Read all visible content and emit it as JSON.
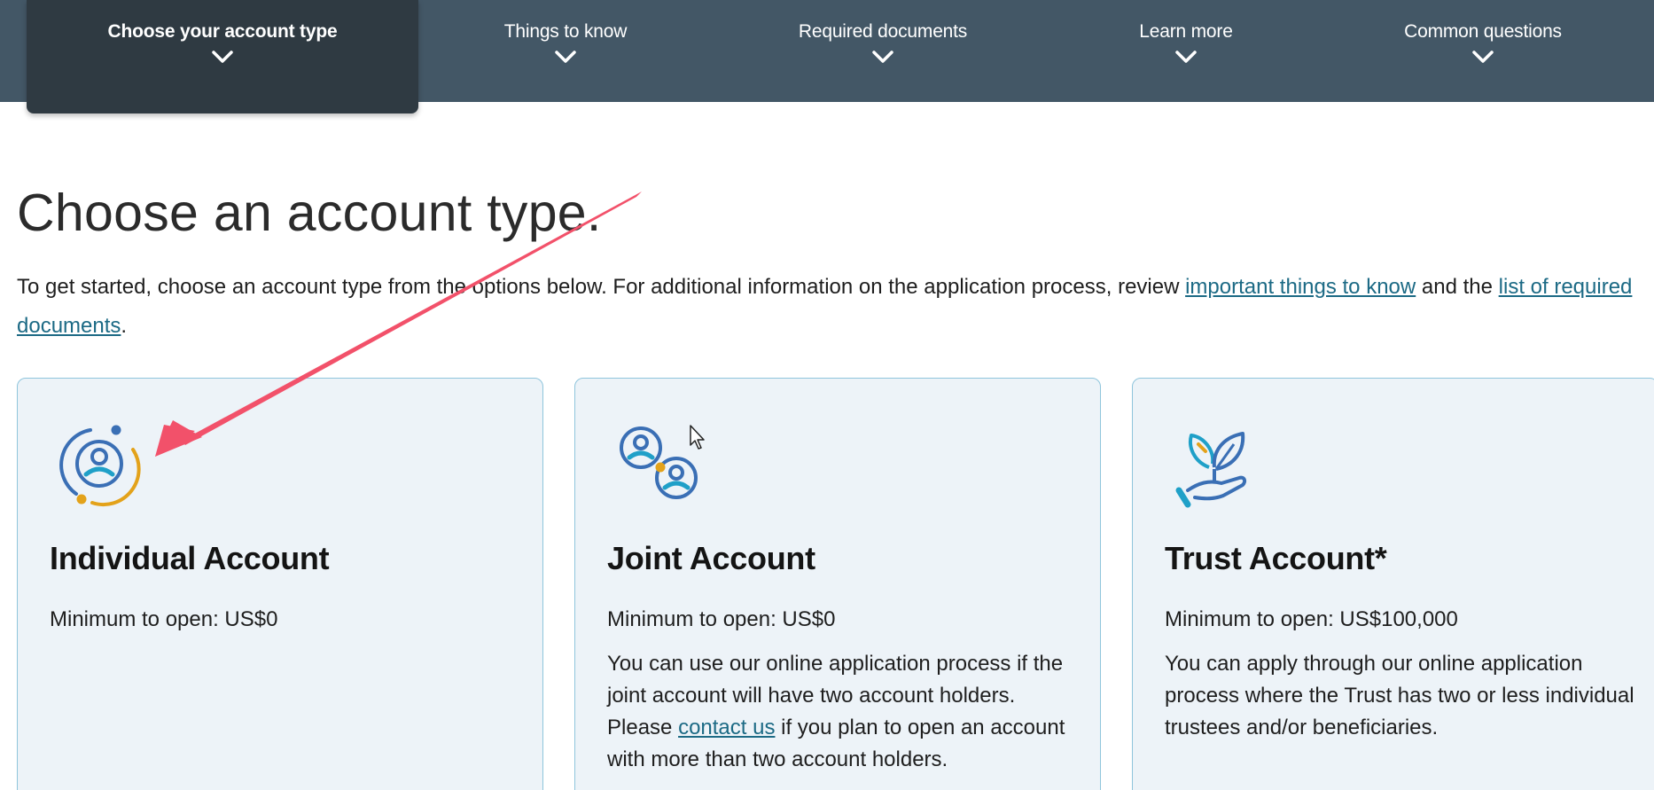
{
  "nav": {
    "tabs": [
      {
        "label": "Choose your account type",
        "active": true
      },
      {
        "label": "Things to know",
        "active": false
      },
      {
        "label": "Required documents",
        "active": false
      },
      {
        "label": "Learn more",
        "active": false
      },
      {
        "label": "Common questions",
        "active": false
      }
    ]
  },
  "main": {
    "title": "Choose an account type.",
    "intro": {
      "text1": "To get started, choose an account type from the options below. For additional information on the application process, review ",
      "link1": "important things to know",
      "text2": " and the ",
      "link2": "list of required documents",
      "text3": "."
    }
  },
  "cards": [
    {
      "icon": "individual-account-icon",
      "title": "Individual Account",
      "minimum": "Minimum to open: US$0"
    },
    {
      "icon": "joint-account-icon",
      "title": "Joint Account",
      "minimum": "Minimum to open: US$0",
      "desc1": "You can use our online application process if the joint account will have two account holders. Please ",
      "desc_link": "contact us",
      "desc2": " if you plan to open an account with more than two account holders."
    },
    {
      "icon": "trust-account-icon",
      "title": "Trust Account*",
      "minimum": "Minimum to open: US$100,000",
      "desc1": "You can apply through our online application process where the Trust has two or less individual trustees and/or beneficiaries."
    }
  ],
  "colors": {
    "nav_bg": "#435766",
    "nav_active_bg": "#2f3a42",
    "card_bg": "#edf3f8",
    "card_border": "#8fc5dc",
    "link": "#1c6a85",
    "icon_blue": "#3a6fb5",
    "icon_teal": "#1fa0c8",
    "icon_gold": "#e3a21a",
    "annotation_arrow": "#f2516a"
  }
}
